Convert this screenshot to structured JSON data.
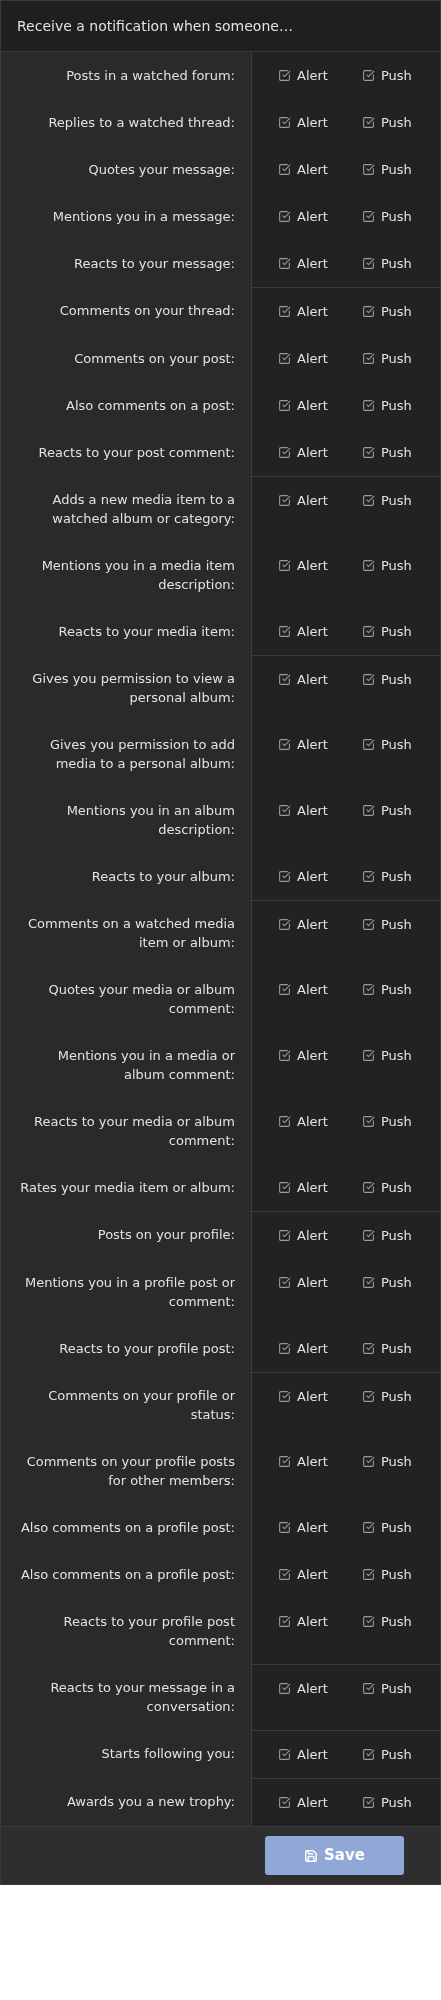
{
  "header": "Receive a notification when someone…",
  "groups": [
    {
      "rows": [
        {
          "label": "Posts in a watched forum:",
          "options": [
            {
              "label": "Alert",
              "checked": true
            },
            {
              "label": "Push",
              "checked": true
            }
          ]
        },
        {
          "label": "Replies to a watched thread:",
          "options": [
            {
              "label": "Alert",
              "checked": true
            },
            {
              "label": "Push",
              "checked": true
            }
          ]
        },
        {
          "label": "Quotes your message:",
          "options": [
            {
              "label": "Alert",
              "checked": true
            },
            {
              "label": "Push",
              "checked": true
            }
          ]
        },
        {
          "label": "Mentions you in a message:",
          "options": [
            {
              "label": "Alert",
              "checked": true
            },
            {
              "label": "Push",
              "checked": true
            }
          ]
        },
        {
          "label": "Reacts to your message:",
          "options": [
            {
              "label": "Alert",
              "checked": true
            },
            {
              "label": "Push",
              "checked": true
            }
          ]
        }
      ]
    },
    {
      "rows": [
        {
          "label": "Comments on your thread:",
          "options": [
            {
              "label": "Alert",
              "checked": true
            },
            {
              "label": "Push",
              "checked": true
            }
          ]
        },
        {
          "label": "Comments on your post:",
          "options": [
            {
              "label": "Alert",
              "checked": true
            },
            {
              "label": "Push",
              "checked": true
            }
          ]
        },
        {
          "label": "Also comments on a post:",
          "options": [
            {
              "label": "Alert",
              "checked": true
            },
            {
              "label": "Push",
              "checked": true
            }
          ]
        },
        {
          "label": "Reacts to your post comment:",
          "options": [
            {
              "label": "Alert",
              "checked": true
            },
            {
              "label": "Push",
              "checked": true
            }
          ]
        }
      ]
    },
    {
      "rows": [
        {
          "label": "Adds a new media item to a watched album or category:",
          "options": [
            {
              "label": "Alert",
              "checked": true
            },
            {
              "label": "Push",
              "checked": true
            }
          ]
        },
        {
          "label": "Mentions you in a media item description:",
          "options": [
            {
              "label": "Alert",
              "checked": true
            },
            {
              "label": "Push",
              "checked": true
            }
          ]
        },
        {
          "label": "Reacts to your media item:",
          "options": [
            {
              "label": "Alert",
              "checked": true
            },
            {
              "label": "Push",
              "checked": true
            }
          ]
        }
      ]
    },
    {
      "rows": [
        {
          "label": "Gives you permission to view a personal album:",
          "options": [
            {
              "label": "Alert",
              "checked": true
            },
            {
              "label": "Push",
              "checked": true
            }
          ]
        },
        {
          "label": "Gives you permission to add media to a personal album:",
          "options": [
            {
              "label": "Alert",
              "checked": true
            },
            {
              "label": "Push",
              "checked": true
            }
          ]
        },
        {
          "label": "Mentions you in an album description:",
          "options": [
            {
              "label": "Alert",
              "checked": true
            },
            {
              "label": "Push",
              "checked": true
            }
          ]
        },
        {
          "label": "Reacts to your album:",
          "options": [
            {
              "label": "Alert",
              "checked": true
            },
            {
              "label": "Push",
              "checked": true
            }
          ]
        }
      ]
    },
    {
      "rows": [
        {
          "label": "Comments on a watched media item or album:",
          "options": [
            {
              "label": "Alert",
              "checked": true
            },
            {
              "label": "Push",
              "checked": true
            }
          ]
        },
        {
          "label": "Quotes your media or album comment:",
          "options": [
            {
              "label": "Alert",
              "checked": true
            },
            {
              "label": "Push",
              "checked": true
            }
          ]
        },
        {
          "label": "Mentions you in a media or album comment:",
          "options": [
            {
              "label": "Alert",
              "checked": true
            },
            {
              "label": "Push",
              "checked": true
            }
          ]
        },
        {
          "label": "Reacts to your media or album comment:",
          "options": [
            {
              "label": "Alert",
              "checked": true
            },
            {
              "label": "Push",
              "checked": true
            }
          ]
        },
        {
          "label": "Rates your media item or album:",
          "options": [
            {
              "label": "Alert",
              "checked": true
            },
            {
              "label": "Push",
              "checked": true
            }
          ]
        }
      ]
    },
    {
      "rows": [
        {
          "label": "Posts on your profile:",
          "options": [
            {
              "label": "Alert",
              "checked": true
            },
            {
              "label": "Push",
              "checked": true
            }
          ]
        },
        {
          "label": "Mentions you in a profile post or comment:",
          "options": [
            {
              "label": "Alert",
              "checked": true
            },
            {
              "label": "Push",
              "checked": true
            }
          ]
        },
        {
          "label": "Reacts to your profile post:",
          "options": [
            {
              "label": "Alert",
              "checked": true
            },
            {
              "label": "Push",
              "checked": true
            }
          ]
        }
      ]
    },
    {
      "rows": [
        {
          "label": "Comments on your profile or status:",
          "options": [
            {
              "label": "Alert",
              "checked": true
            },
            {
              "label": "Push",
              "checked": true
            }
          ]
        },
        {
          "label": "Comments on your profile posts for other members:",
          "options": [
            {
              "label": "Alert",
              "checked": true
            },
            {
              "label": "Push",
              "checked": true
            }
          ]
        },
        {
          "label": "Also comments on a profile post:",
          "options": [
            {
              "label": "Alert",
              "checked": true
            },
            {
              "label": "Push",
              "checked": true
            }
          ]
        },
        {
          "label": "Also comments on a profile post:",
          "options": [
            {
              "label": "Alert",
              "checked": true
            },
            {
              "label": "Push",
              "checked": true
            }
          ]
        },
        {
          "label": "Reacts to your profile post comment:",
          "options": [
            {
              "label": "Alert",
              "checked": true
            },
            {
              "label": "Push",
              "checked": true
            }
          ]
        }
      ]
    },
    {
      "rows": [
        {
          "label": "Reacts to your message in a conversation:",
          "options": [
            {
              "label": "Alert",
              "checked": true
            },
            {
              "label": "Push",
              "checked": true
            }
          ]
        }
      ]
    },
    {
      "rows": [
        {
          "label": "Starts following you:",
          "options": [
            {
              "label": "Alert",
              "checked": true
            },
            {
              "label": "Push",
              "checked": true
            }
          ]
        }
      ]
    },
    {
      "rows": [
        {
          "label": "Awards you a new trophy:",
          "options": [
            {
              "label": "Alert",
              "checked": true
            },
            {
              "label": "Push",
              "checked": true
            }
          ]
        }
      ]
    }
  ],
  "save_button": "Save"
}
